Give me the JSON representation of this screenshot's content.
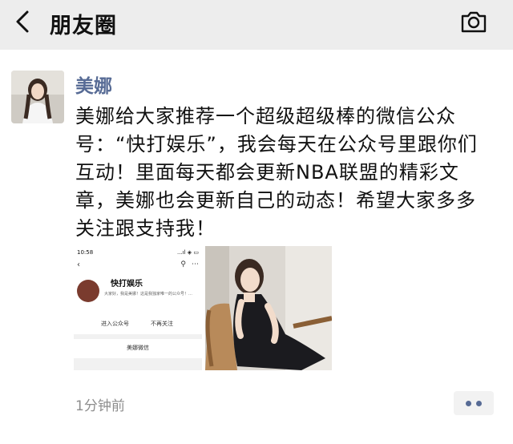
{
  "nav": {
    "title": "朋友圈"
  },
  "post": {
    "author": "美娜",
    "text": "美娜给大家推荐一个超级超级棒的微信公众号：“快打娱乐”，我会每天在公众号里跟你们互动！里面每天都会更新NBA联盟的精彩文章，美娜也会更新自己的动态！希望大家多多关注跟支持我！",
    "time": "1分钟前"
  },
  "mini_screen": {
    "status_time": "10:58",
    "status_right": "...ıl ◈ ▭",
    "account_name": "快打娱乐",
    "description": "大家好，我是美娜！这是我独家唯一的公众号！…",
    "enter_button": "进入公众号",
    "unfollow_button": "不再关注",
    "wechat_label": "美娜微信"
  },
  "colors": {
    "link": "#576b95",
    "muted": "#8d8d8d",
    "background": "#ededed"
  }
}
